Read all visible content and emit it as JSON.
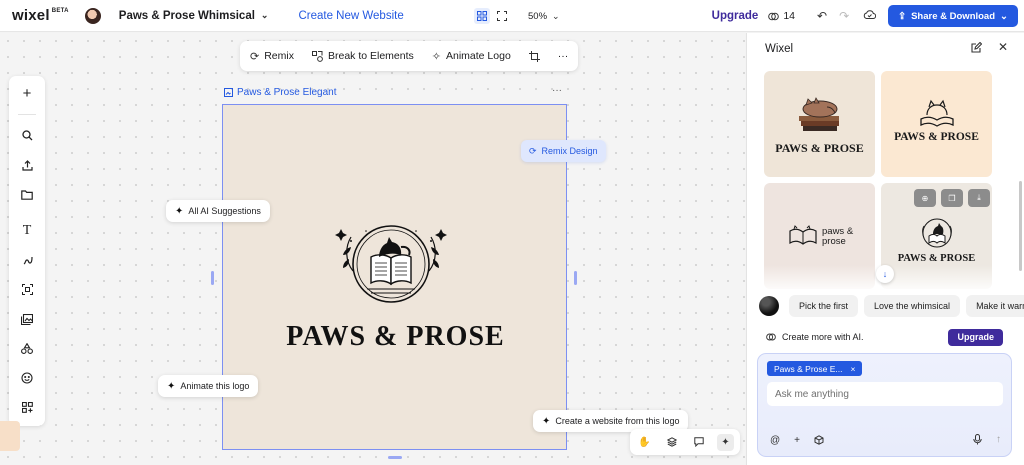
{
  "topbar": {
    "brand": "wixel",
    "brand_badge": "BETA",
    "project_name": "Paws & Prose Whimsical",
    "create_website": "Create New Website",
    "zoom": "50%",
    "upgrade": "Upgrade",
    "credits": "14",
    "share": "Share & Download"
  },
  "toolbar": {
    "remix": "Remix",
    "break": "Break to Elements",
    "animate": "Animate Logo",
    "more": "···"
  },
  "artboard": {
    "label": "Paws & Prose Elegant",
    "more": "···",
    "logo_text": "PAWS & PROSE"
  },
  "chips": {
    "remix_design": "Remix Design",
    "all_suggestions": "All AI Suggestions",
    "animate_logo": "Animate this logo",
    "create_website": "Create a website from this logo"
  },
  "panel": {
    "title": "Wixel",
    "thumbs": [
      {
        "text": "PAWS & PROSE",
        "bg": "#efe5d8"
      },
      {
        "text": "PAWS & PROSE",
        "bg": "#fbe8d2"
      },
      {
        "text_line1": "paws &",
        "text_line2": "prose",
        "bg": "#eee4df"
      },
      {
        "text": "PAWS & PROSE",
        "bg": "#ede8e1"
      }
    ],
    "suggestions": [
      "Pick the first",
      "Love the whimsical",
      "Make it warmer"
    ],
    "create_more": "Create more with AI.",
    "upgrade": "Upgrade",
    "context_chip": "Paws & Prose E...",
    "context_close": "×",
    "ask_placeholder": "Ask me anything"
  },
  "colors": {
    "accent": "#2459e0",
    "upgrade": "#3f2b9c",
    "artboard_bg": "#eee5da"
  }
}
